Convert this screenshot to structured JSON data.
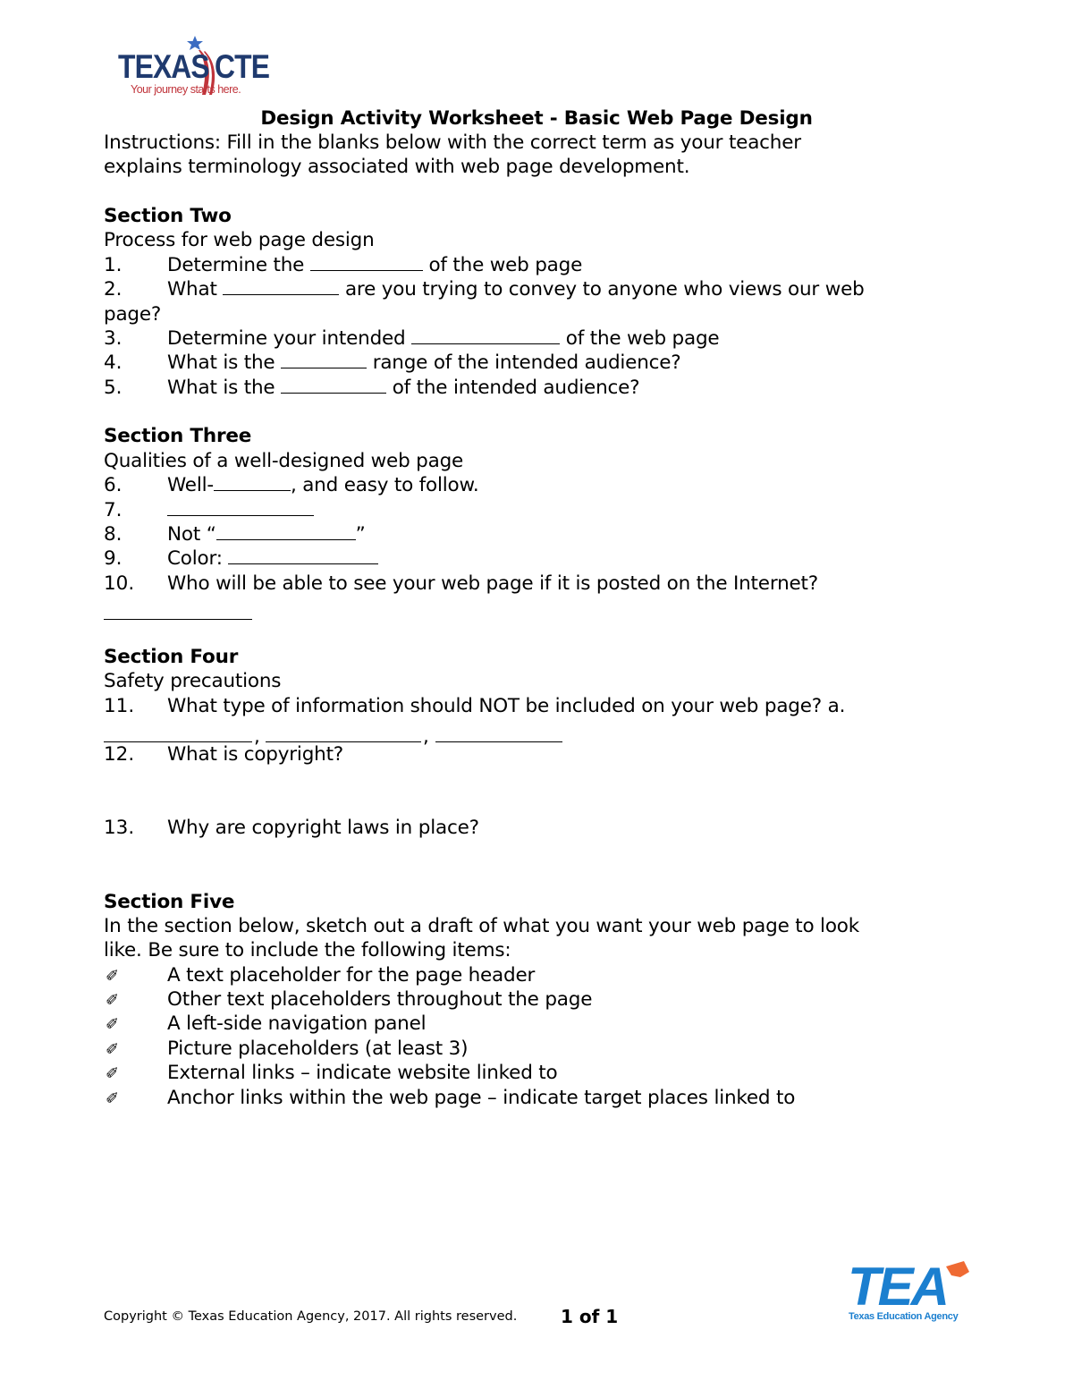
{
  "header_logo": {
    "word_left": "TEXAS",
    "word_right": "CTE",
    "tagline": "Your journey starts here.",
    "colors": {
      "navy": "#1f3a6e",
      "red": "#c0343b",
      "star": "#3b6cc2"
    }
  },
  "title": "Design Activity Worksheet - Basic Web Page Design",
  "instructions": [
    "Instructions: Fill in the blanks below with the correct term as your teacher",
    "explains terminology associated with web page development."
  ],
  "section_two": {
    "heading": "Section Two",
    "subheading": "Process for web page design",
    "items": [
      {
        "num": "1.",
        "before": "Determine the ",
        "after": " of the web page"
      },
      {
        "num": "2.",
        "before": "What ",
        "after": " are you trying to convey to anyone who views our web",
        "continuation": "page?"
      },
      {
        "num": "3.",
        "before": "Determine your intended ",
        "after": " of the web page"
      },
      {
        "num": "4.",
        "before": "What is the ",
        "after": " range of the intended audience?"
      },
      {
        "num": "5.",
        "before": "What is the ",
        "after": " of the intended audience?"
      }
    ]
  },
  "section_three": {
    "heading": "Section Three",
    "subheading": "Qualities of a well-designed web page",
    "items": [
      {
        "num": "6.",
        "before": "Well-",
        "after": ", and easy to follow."
      },
      {
        "num": "7.",
        "before": "",
        "after": ""
      },
      {
        "num": "8.",
        "before": "Not “",
        "after": "”"
      },
      {
        "num": "9.",
        "before": "Color: ",
        "after": ""
      },
      {
        "num": "10.",
        "before": "Who will be able to see your web page if it is posted on the Internet?",
        "after": ""
      }
    ]
  },
  "section_four": {
    "heading": "Section Four",
    "subheading": "Safety precautions",
    "items": [
      {
        "num": "11.",
        "text": "What type of information should NOT be included on your web page? a."
      },
      {
        "num": "12.",
        "text": "What is copyright?"
      },
      {
        "num": "13.",
        "text": "Why are copyright laws in place?"
      }
    ],
    "separator": ","
  },
  "section_five": {
    "heading": "Section Five",
    "intro": [
      "In the section below, sketch out a draft of what you want your web page to look",
      "like. Be sure to include the following items:"
    ],
    "bullet_icon": "clapperboard-icon",
    "bullet_glyph": "✐",
    "items": [
      "A text placeholder for the page header",
      "Other text placeholders throughout the page",
      "A left-side navigation panel",
      "Picture placeholders (at least 3)",
      "External links – indicate website linked to",
      "Anchor links within the web page – indicate target places linked to"
    ]
  },
  "footer": {
    "copyright": "Copyright © Texas Education Agency, 2017. All rights reserved.",
    "page": "1 of 1",
    "tea_logo": {
      "letters": "TEA",
      "subtitle": "Texas Education Agency",
      "colors": {
        "blue": "#1b7fcf",
        "orange": "#ef6a33"
      }
    }
  }
}
